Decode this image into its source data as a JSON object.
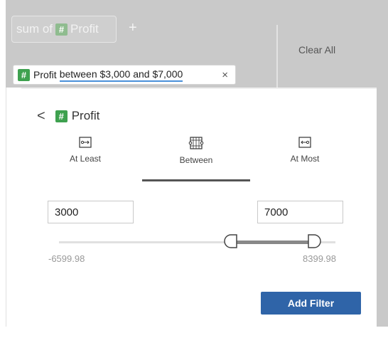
{
  "shelf": {
    "pill_prefix": "sum of",
    "pill_field": "Profit",
    "add_label": "+",
    "clear_all_label": "Clear All"
  },
  "filter_chip": {
    "field": "Profit",
    "condition": "between $3,000 and $7,000",
    "close_label": "×"
  },
  "panel": {
    "back_label": "<",
    "field": "Profit",
    "tabs": [
      {
        "label": "At Least",
        "icon": "at-least-icon"
      },
      {
        "label": "Between",
        "icon": "between-icon",
        "selected": true
      },
      {
        "label": "At Most",
        "icon": "at-most-icon"
      }
    ],
    "min_value": "3000",
    "max_value": "7000",
    "range_min_label": "-6599.98",
    "range_max_label": "8399.98",
    "add_filter_label": "Add Filter"
  },
  "colors": {
    "accent_button": "#2f64a8",
    "measure_green": "#3ea14f",
    "underline_blue": "#4a90d9"
  }
}
